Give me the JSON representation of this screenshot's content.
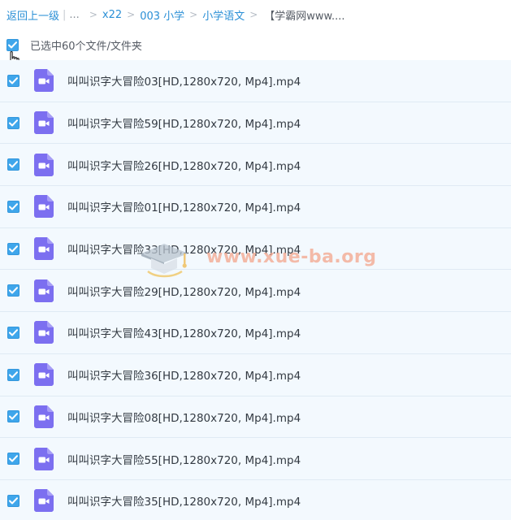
{
  "breadcrumb": {
    "back_label": "返回上一级",
    "separator": "|",
    "ellipsis": "...",
    "arrow": ">",
    "items": [
      "x22",
      "003 小学",
      "小学语文"
    ],
    "current": "【学霸网www...."
  },
  "select_all": {
    "label": "已选中60个文件/文件夹"
  },
  "files": [
    {
      "name": "叫叫识字大冒险03[HD,1280x720, Mp4].mp4"
    },
    {
      "name": "叫叫识字大冒险59[HD,1280x720, Mp4].mp4"
    },
    {
      "name": "叫叫识字大冒险26[HD,1280x720, Mp4].mp4"
    },
    {
      "name": "叫叫识字大冒险01[HD,1280x720, Mp4].mp4"
    },
    {
      "name": "叫叫识字大冒险33[HD,1280x720, Mp4].mp4"
    },
    {
      "name": "叫叫识字大冒险29[HD,1280x720, Mp4].mp4"
    },
    {
      "name": "叫叫识字大冒险43[HD,1280x720, Mp4].mp4"
    },
    {
      "name": "叫叫识字大冒险36[HD,1280x720, Mp4].mp4"
    },
    {
      "name": "叫叫识字大冒险08[HD,1280x720, Mp4].mp4"
    },
    {
      "name": "叫叫识字大冒险55[HD,1280x720, Mp4].mp4"
    },
    {
      "name": "叫叫识字大冒险35[HD,1280x720, Mp4].mp4"
    }
  ],
  "watermark": {
    "text": "www.xue-ba.org"
  },
  "colors": {
    "accent": "#3fa6eb",
    "link": "#2a8fd6",
    "row_background": "#f3f9fe",
    "video_icon": "#7c6ff0"
  },
  "icons": {
    "checkbox": "check-icon",
    "file": "video-file-icon",
    "cursor": "hand-cursor-icon"
  }
}
